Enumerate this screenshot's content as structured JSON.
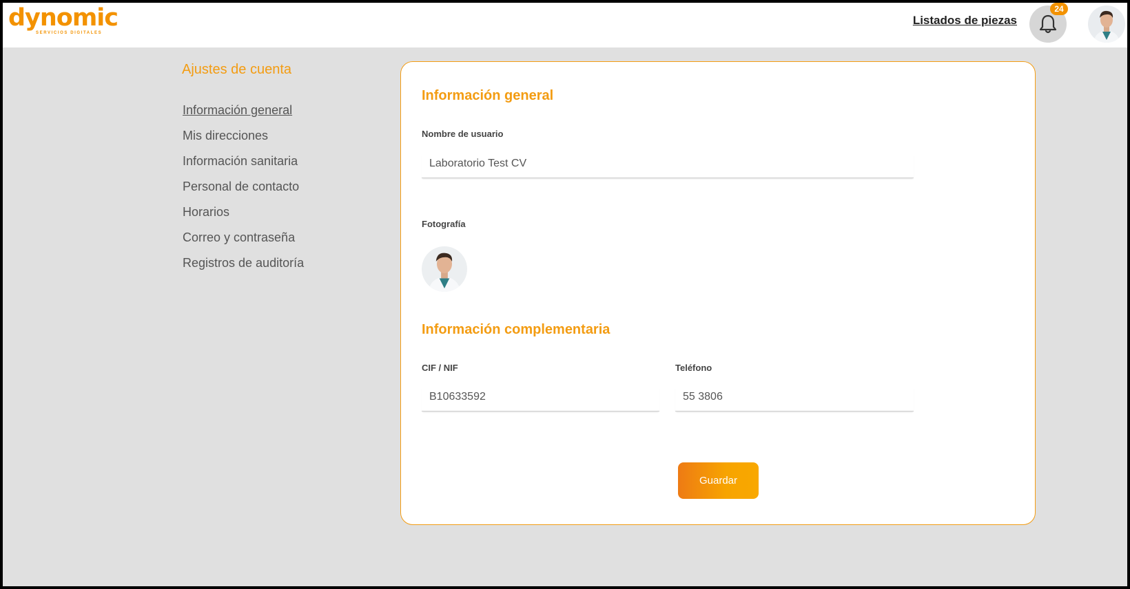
{
  "header": {
    "logo_text": "dynomic",
    "logo_tagline": "SERVICIOS DIGITALES",
    "nav_link": "Listados de piezas",
    "notifications_count": "24",
    "colors": {
      "brand_orange": "#f39200",
      "brand_red": "#e8561c"
    }
  },
  "sidebar": {
    "title": "Ajustes de cuenta",
    "items": [
      {
        "label": "Información general",
        "active": true
      },
      {
        "label": "Mis direcciones"
      },
      {
        "label": "Información sanitaria"
      },
      {
        "label": "Personal de contacto"
      },
      {
        "label": "Horarios"
      },
      {
        "label": "Correo y contraseña"
      },
      {
        "label": "Registros de auditoría"
      }
    ]
  },
  "main": {
    "general_title": "Información general",
    "username_label": "Nombre de usuario",
    "username_value": "Laboratorio Test CV",
    "photo_label": "Fotografía",
    "complementary_title": "Información complementaria",
    "cif_label": "CIF / NIF",
    "cif_value": "B10633592",
    "phone_label": "Teléfono",
    "phone_value": "55 3806",
    "save_label": "Guardar",
    "accent_color": "#f39c12"
  }
}
